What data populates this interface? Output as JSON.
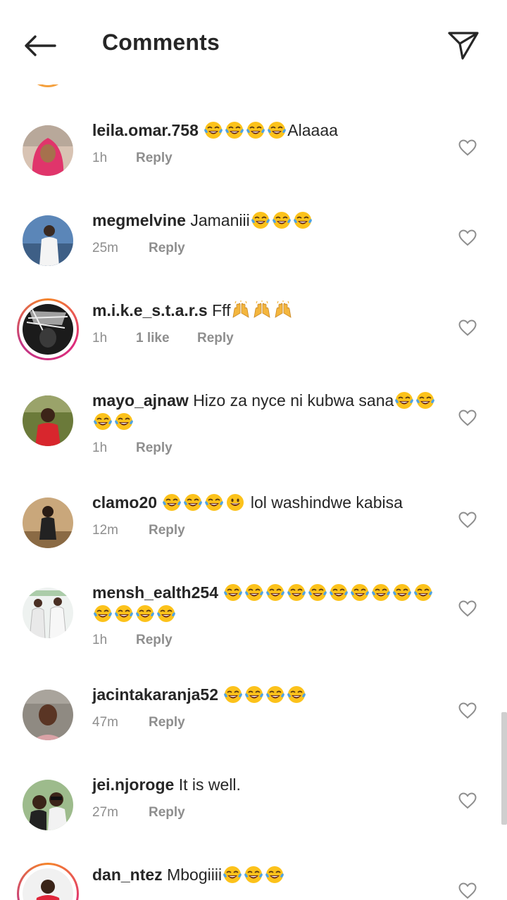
{
  "header": {
    "title": "Comments"
  },
  "colors": {
    "story_ring": "#dd2a7b",
    "meta_text": "#8e8e8e",
    "text": "#262626"
  },
  "icons": {
    "back": "arrow-left-icon",
    "share": "paper-plane-icon",
    "like": "heart-outline-icon",
    "emoji": "tears-of-joy-emoji"
  },
  "comments": [
    {
      "username": "leila.omar.758",
      "text_before": "",
      "emoji_count": 4,
      "text_after": "Alaaaa",
      "time": "1h",
      "likes": "",
      "reply": "Reply"
    },
    {
      "username": "megmelvine",
      "text_before": "Jamaniii",
      "emoji_count": 3,
      "text_after": "",
      "time": "25m",
      "likes": "",
      "reply": "Reply"
    },
    {
      "username": "m.i.k.e_s.t.a.r.s",
      "text_before": "Fff",
      "emoji_count": 0,
      "text_after": "",
      "time": "1h",
      "likes": "1 like",
      "reply": "Reply"
    },
    {
      "username": "mayo_ajnaw",
      "text_before": "Hizo za nyce ni kubwa sana",
      "emoji_count": 4,
      "text_after": "",
      "time": "1h",
      "likes": "",
      "reply": "Reply"
    },
    {
      "username": "clamo20",
      "text_before": "",
      "emoji_count": 4,
      "text_after": "lol washindwe kabisa",
      "time": "12m",
      "likes": "",
      "reply": "Reply"
    },
    {
      "username": "mensh_ealth254",
      "text_before": "",
      "emoji_count": 14,
      "text_after": "",
      "time": "1h",
      "likes": "",
      "reply": "Reply"
    },
    {
      "username": "jacintakaranja52",
      "text_before": "",
      "emoji_count": 4,
      "text_after": "",
      "time": "47m",
      "likes": "",
      "reply": "Reply"
    },
    {
      "username": "jei.njoroge",
      "text_before": "It is well.",
      "emoji_count": 0,
      "text_after": "",
      "time": "27m",
      "likes": "",
      "reply": "Reply"
    },
    {
      "username": "dan_ntez",
      "text_before": "Mbogiiii",
      "emoji_count": 3,
      "text_after": "",
      "time": "",
      "likes": "",
      "reply": ""
    }
  ]
}
